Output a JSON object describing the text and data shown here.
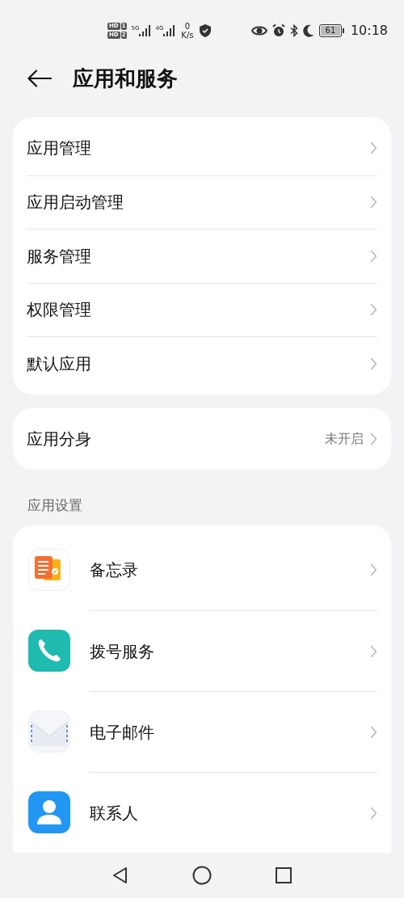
{
  "status_bar": {
    "sims": [
      {
        "badge": "HD",
        "slot": "1"
      },
      {
        "badge": "HD",
        "slot": "2"
      }
    ],
    "networks": [
      "5G",
      "4G"
    ],
    "speed_value": "0",
    "speed_unit": "K/s",
    "battery": "61",
    "time": "10:18"
  },
  "header": {
    "title": "应用和服务"
  },
  "main_menu": [
    {
      "label": "应用管理"
    },
    {
      "label": "应用启动管理"
    },
    {
      "label": "服务管理"
    },
    {
      "label": "权限管理"
    },
    {
      "label": "默认应用"
    }
  ],
  "clone_row": {
    "label": "应用分身",
    "value": "未开启"
  },
  "section": {
    "title": "应用设置",
    "apps": [
      {
        "label": "备忘录",
        "kind": "notes"
      },
      {
        "label": "拨号服务",
        "kind": "phone"
      },
      {
        "label": "电子邮件",
        "kind": "mail"
      },
      {
        "label": "联系人",
        "kind": "contact"
      }
    ]
  }
}
